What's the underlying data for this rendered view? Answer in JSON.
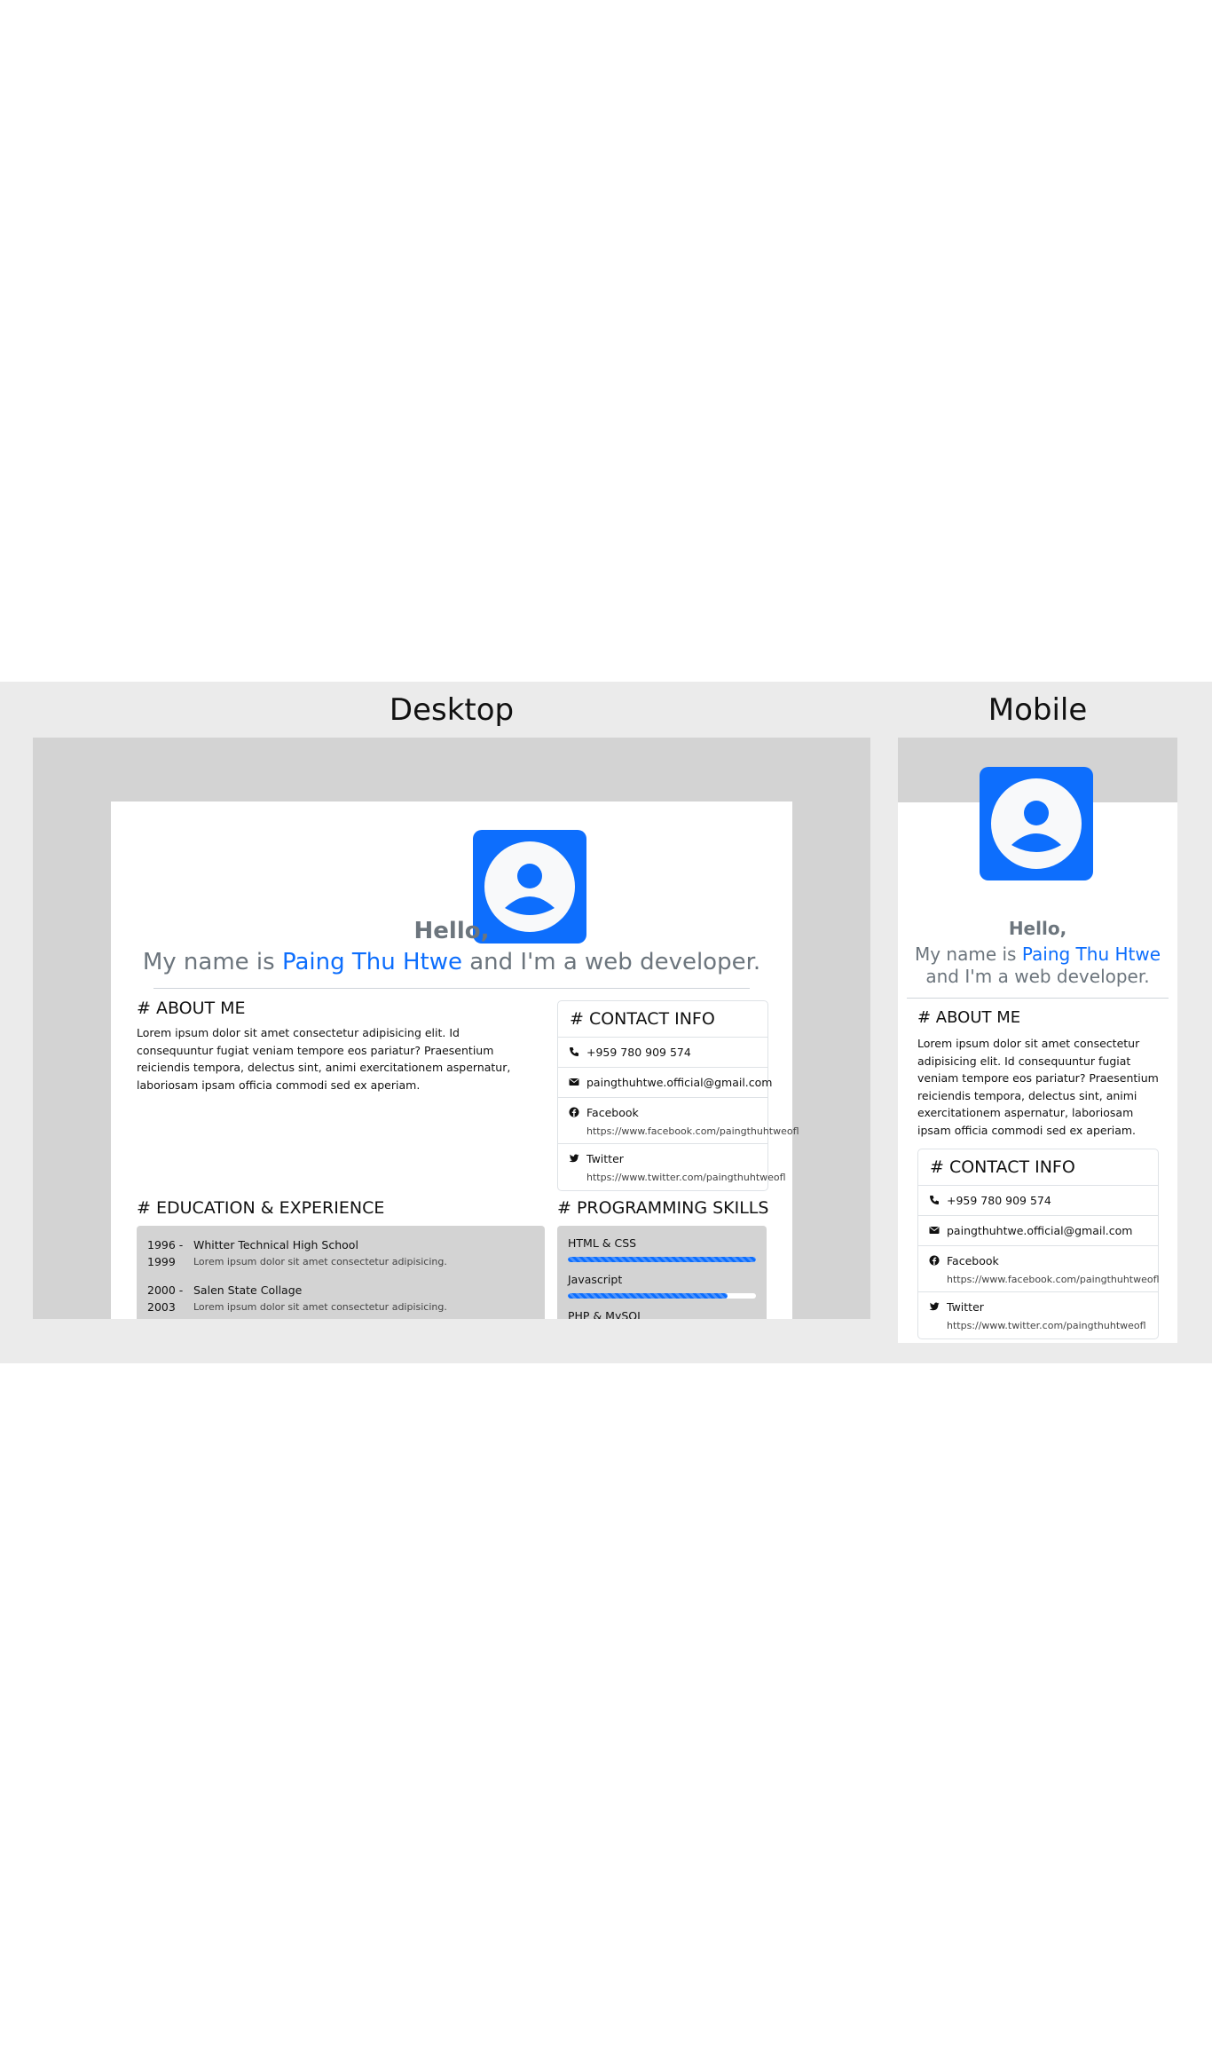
{
  "labels": {
    "desktop": "Desktop",
    "mobile": "Mobile"
  },
  "colors": {
    "accent": "#0d6efd",
    "muted_text": "#6c757d",
    "frame_bg": "#d3d3d3",
    "band_bg": "#ebebeb"
  },
  "icons": {
    "avatar": "user-circle-icon",
    "phone": "phone-icon",
    "email": "envelope-icon",
    "facebook": "facebook-icon",
    "twitter": "twitter-icon"
  },
  "hero": {
    "greeting": "Hello,",
    "intro_prefix": "My name is",
    "name": "Paing Thu Htwe",
    "intro_suffix": "and I'm a web developer."
  },
  "about": {
    "heading": "# ABOUT ME",
    "text": "Lorem ipsum dolor sit amet consectetur adipisicing elit. Id consequuntur fugiat veniam tempore eos pariatur? Praesentium reiciendis tempora, delectus sint, animi exercitationem aspernatur, laboriosam ipsam officia commodi sed ex aperiam."
  },
  "contact": {
    "heading": "# CONTACT INFO",
    "phone": "+959 780 909 574",
    "email": "paingthuhtwe.official@gmail.com",
    "facebook": {
      "label": "Facebook",
      "url": "https://www.facebook.com/paingthuhtweofl"
    },
    "twitter": {
      "label": "Twitter",
      "url": "https://www.twitter.com/paingthuhtweofl"
    }
  },
  "education": {
    "heading": "# EDUCATION & EXPERIENCE",
    "items": [
      {
        "years": "1996 - 1999",
        "title": "Whitter Technical High School",
        "desc": "Lorem ipsum dolor sit amet consectetur adipisicing."
      },
      {
        "years": "2000 - 2003",
        "title": "Salen State Collage",
        "desc": "Lorem ipsum dolor sit amet consectetur adipisicing."
      }
    ]
  },
  "skills": {
    "heading": "# PROGRAMMING SKILLS",
    "items": [
      {
        "name": "HTML & CSS",
        "level": 100
      },
      {
        "name": "Javascript",
        "level": 85
      },
      {
        "name": "PHP & MySQL"
      }
    ]
  }
}
